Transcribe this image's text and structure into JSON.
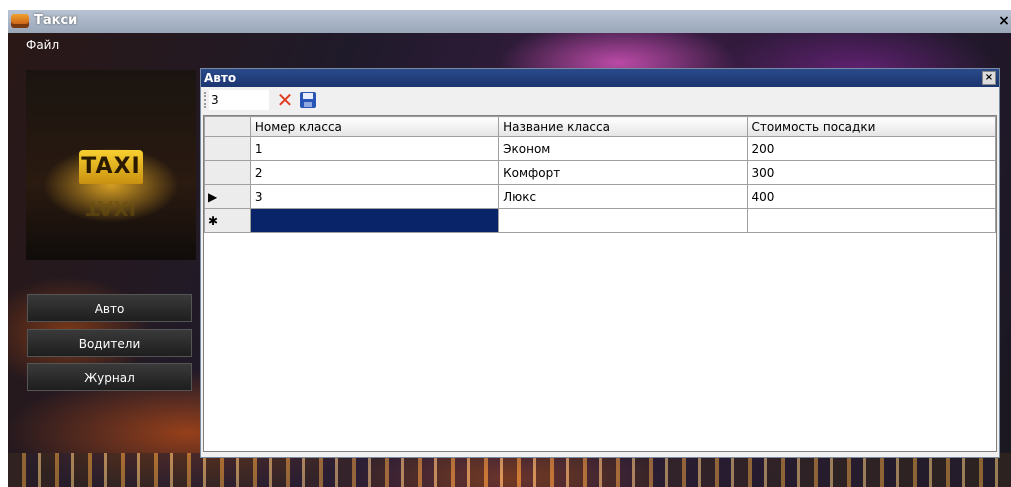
{
  "app": {
    "title": "Такси",
    "close_glyph": "×",
    "icon": "taxi-app-icon"
  },
  "menu": {
    "file": "Файл"
  },
  "logo": {
    "text": "TAXI"
  },
  "sidebar": {
    "buttons": [
      {
        "label": "Авто"
      },
      {
        "label": "Водители"
      },
      {
        "label": "Журнал"
      }
    ]
  },
  "child": {
    "title": "Авто",
    "close_glyph": "×",
    "toolbar": {
      "value": "3",
      "delete_glyph": "✕",
      "save_icon": "save-icon"
    },
    "grid": {
      "columns": [
        "Номер класса",
        "Название класса",
        "Стоимость посадки"
      ],
      "rows": [
        {
          "indicator": "",
          "cells": [
            "1",
            "Эконом",
            "200"
          ]
        },
        {
          "indicator": "",
          "cells": [
            "2",
            "Комфорт",
            "300"
          ]
        },
        {
          "indicator": "▶",
          "cells": [
            "3",
            "Люкс",
            "400"
          ]
        },
        {
          "indicator": "✱",
          "cells": [
            "",
            "",
            ""
          ]
        }
      ]
    },
    "selection_color": "#0a246a"
  },
  "colors": {
    "title_bar": "#1b3570",
    "accent_red": "#e03a20",
    "save_blue": "#2a55b8"
  }
}
